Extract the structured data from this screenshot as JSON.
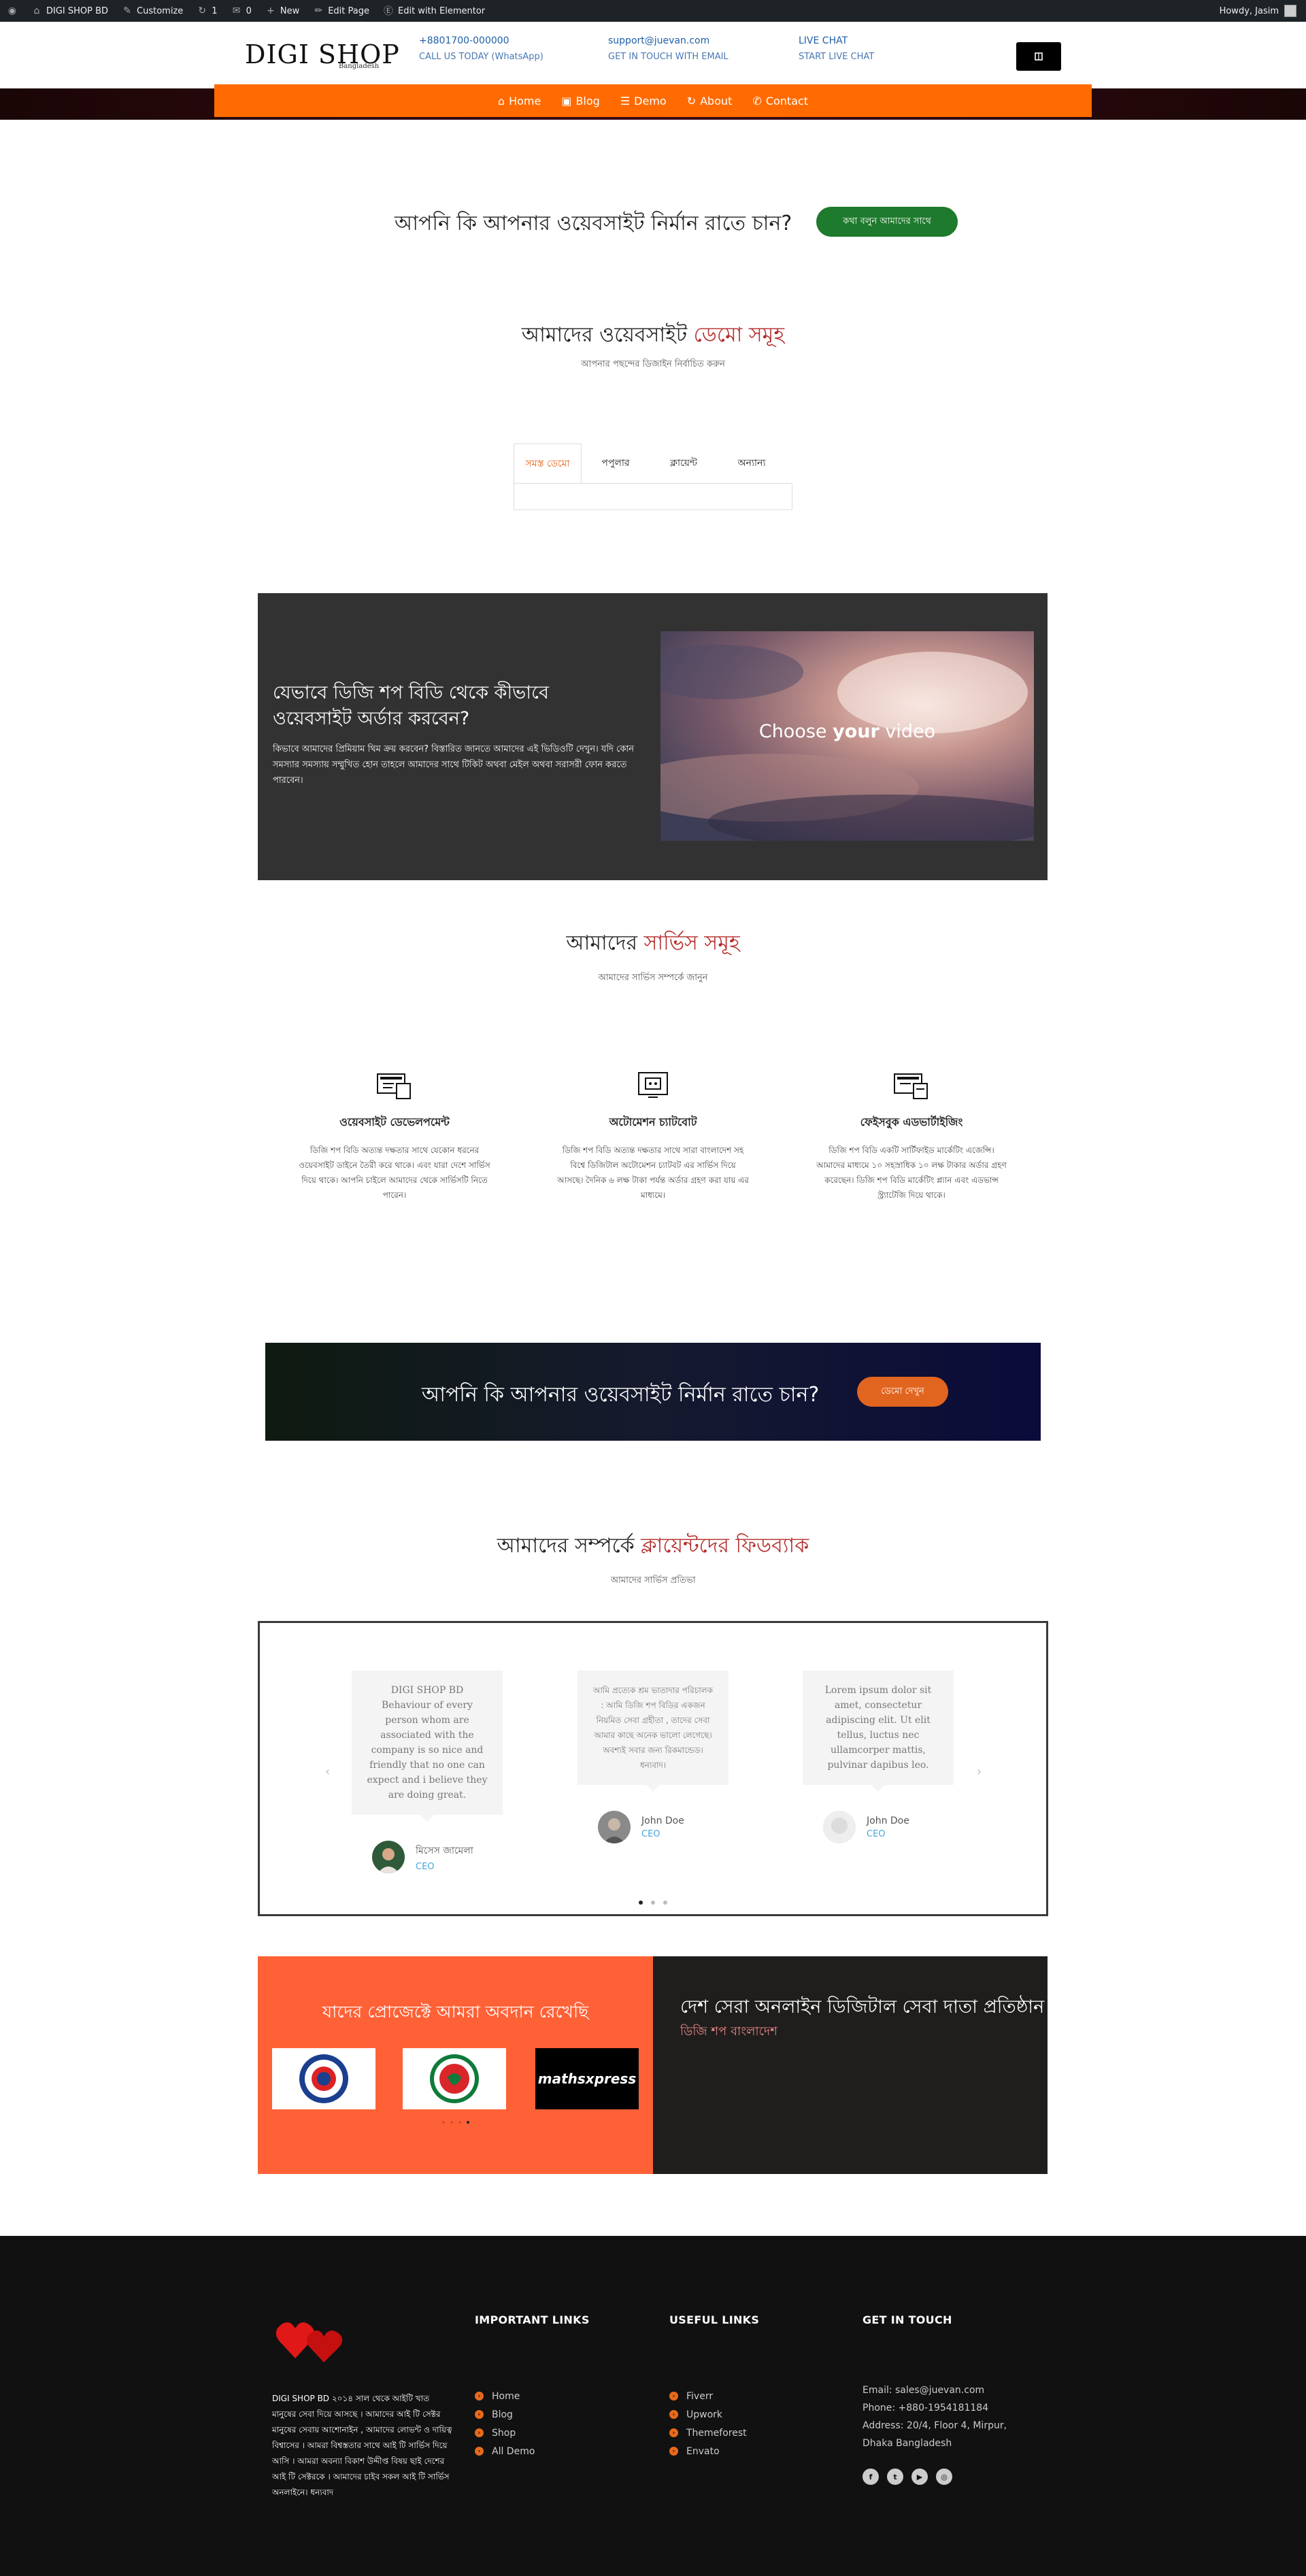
{
  "admin_bar": {
    "items": [
      {
        "label": "DIGI SHOP BD",
        "icon": "home-icon"
      },
      {
        "label": "Customize",
        "icon": "brush-icon"
      },
      {
        "label": "1",
        "icon": "refresh-icon"
      },
      {
        "label": "0",
        "icon": "comment-icon"
      },
      {
        "label": "New",
        "icon": "plus-icon"
      },
      {
        "label": "Edit Page",
        "icon": "pencil-icon"
      },
      {
        "label": "Edit with Elementor",
        "icon": "elementor-icon"
      }
    ],
    "greeting": "Howdy, Jasim"
  },
  "header": {
    "logo": "DIGI SHOP",
    "logo_sub": "Bangladesh",
    "contacts": [
      {
        "line1": "+8801700-000000",
        "line2": "CALL US TODAY (WhatsApp)"
      },
      {
        "line1": "support@juevan.com",
        "line2": "GET IN TOUCH WITH EMAIL"
      },
      {
        "line1": "LIVE CHAT",
        "line2": "START LIVE CHAT"
      }
    ]
  },
  "nav": [
    {
      "label": "Home",
      "icon": "home-icon"
    },
    {
      "label": "Blog",
      "icon": "book-icon"
    },
    {
      "label": "Demo",
      "icon": "list-icon"
    },
    {
      "label": "About",
      "icon": "refresh-icon"
    },
    {
      "label": "Contact",
      "icon": "phone-icon"
    }
  ],
  "hero": {
    "text": "আপনি কি আপনার ওয়েবসাইট নির্মান রাতে চান?",
    "button": "কথা বলুন আমাদের সাথে"
  },
  "demos": {
    "title": "আমাদের ওয়েবসাইট",
    "title_highlight": "ডেমো সমূহ",
    "subtitle": "আপনার পছন্দের ডিজাইন নির্বাচিত করুন",
    "tabs": [
      "সমস্ত ডেমো",
      "পপুলার",
      "ক্লায়েন্ট",
      "অন্যান্য"
    ]
  },
  "video_section": {
    "title": "যেভাবে ডিজি শপ বিডি থেকে কীভাবে ওয়েবসাইট অর্ডার করবেন?",
    "text": "কিভাবে আমাদের প্রিমিয়াম থিম ক্রয় করবেন? বিস্তারিত জানতে আমাদের এই ভিডিওটি দেখুন। যদি কোন সমস্যার সমস্যায় সম্মুখিত হোন তাহলে আমাদের সাথে টিকিট অথবা মেইল অথবা সরাসরী ফোন করতে পারবেন।",
    "video_label_pre": "Choose",
    "video_label_bold": "your",
    "video_label_post": "video"
  },
  "services": {
    "title": "আমাদের",
    "title_highlight": "সার্ভিস সমূহ",
    "subtitle": "আমাদের সার্ভিস সম্পর্কে জানুন",
    "items": [
      {
        "title": "ওয়েবসাইট ডেভেলপমেন্ট",
        "text": "ডিজি শপ বিডি অত্যন্ত দক্ষতার সাথে যেকোন ধরনের ওয়েবসাইট ডাইনে তৈরী করে থাকে। এবং যারা দেশে সার্ভিস দিয়ে থাকে। আপনি চাইলে আমাদের থেকে সার্ভিসটি নিতে পারেন।",
        "icon": "website-dev-icon"
      },
      {
        "title": "অটোমেশন চ্যাটবোট",
        "text": "ডিজি শপ বিডি অত্যন্ত দক্ষতার সাথে সারা বাংলাদেশ সহ বিশ্বে ডিজিটাল অটোমেশন চ্যাটবট এর সার্ভিস দিয়ে আসছে। দৈনিক ৬ লক্ষ টাকা পর্যন্ত অর্ডার গ্রহণ করা যায় এর মাধ্যমে।",
        "icon": "chatbot-icon"
      },
      {
        "title": "ফেইসবুক এডভার্টাইজিং",
        "text": "ডিজি শপ বিডি একটি সার্টিফাইড মার্কেটিং এজেন্সি। আমাদের মাধ্যমে ১০ সহস্রাধিক ১০ লক্ষ টাকার অর্ডার গ্রহণ করেছেন। ডিজি শপ বিডি মার্কেটিং প্ল্যান এবং এডভান্স স্ট্র্যাটেজি দিয়ে থাকে।",
        "icon": "facebook-ads-icon"
      }
    ]
  },
  "dark_cta": {
    "text": "আপনি কি আপনার ওয়েবসাইট নির্মান রাতে চান?",
    "button": "ডেমো দেখুন"
  },
  "testimonials": {
    "title": "আমাদের সম্পর্কে",
    "title_highlight": "ক্লায়েন্টদের ফিডব্যাক",
    "subtitle": "আমাদের সার্ভিস প্রতিভা",
    "items": [
      {
        "quote": "DIGI SHOP BD Behaviour of every person whom are associated with the company is so nice and friendly that no one can expect and i believe they are doing great.",
        "name": "মিসেস জামেলা",
        "role": "CEO"
      },
      {
        "quote": "আমি প্রত্যেক শ্রম ভাতাদার পরিচালক : আমি ডিজি শপ বিডির একজন নিয়মিত সেবা গ্রহীতা , তাদের সেবা আমার কাছে অনেক ভালো লেগেছে। অবশ্যই সবার জন্য রিকমান্ডেড। ধন্যবাদ।",
        "name": "John Doe",
        "role": "CEO"
      },
      {
        "quote": "Lorem ipsum dolor sit amet, consectetur adipiscing elit. Ut elit tellus, luctus nec ullamcorper mattis, pulvinar dapibus leo.",
        "name": "John Doe",
        "role": "CEO"
      }
    ]
  },
  "clients": {
    "title": "যাদের প্রোজেক্টে আমরা অবদান রেখেছি",
    "logos": [
      "bangladesh-police-logo",
      "govt-bangladesh-logo",
      "mathsxpress"
    ],
    "right_title": "দেশ সেরা অনলাইন ডিজিটাল সেবা দাতা প্রতিষ্ঠান",
    "right_sub": "ডিজি শপ বাংলাদেশ"
  },
  "footer": {
    "about": "DIGI SHOP BD ২০১৪ সাল থেকে আইটি খাত মানুষের সেবা দিয়ে আসছে । আমাদের আই টি সেক্টর মানুষের সেবায় আশোনাইন , আমাদের লোভন্ট ও দায়িত্ব বিশ্বাসের । আমরা বিশ্বস্ততার সাথে আই টি সার্ভিস দিয়ে আসি । আমরা অবন্যা বিকাশ উদ্দীপ্ত বিষয় ছাই দেশের আই টি সেক্টরকে । আমাদের চাইব সকল আই টি সার্ভিস অনলাইনে। ধন্যবাদ",
    "important_title": "IMPORTANT LINKS",
    "important_links": [
      "Home",
      "Blog",
      "Shop",
      "All Demo"
    ],
    "useful_title": "USEFUL LINKS",
    "useful_links": [
      "Fiverr",
      "Upwork",
      "Themeforest",
      "Envato"
    ],
    "contact_title": "GET IN TOUCH",
    "email": "Email: sales@juevan.com",
    "phone": "Phone: +880-1954181184",
    "address": "Address: 20/4, Floor 4, Mirpur, Dhaka Bangladesh",
    "social": [
      "facebook-icon",
      "twitter-icon",
      "youtube-icon",
      "dribbble-icon"
    ]
  },
  "colors": {
    "accent_orange": "#ff6b00",
    "green_button": "#1e7a2c",
    "highlight_red": "#b42a2a",
    "coral": "#ff6137"
  }
}
